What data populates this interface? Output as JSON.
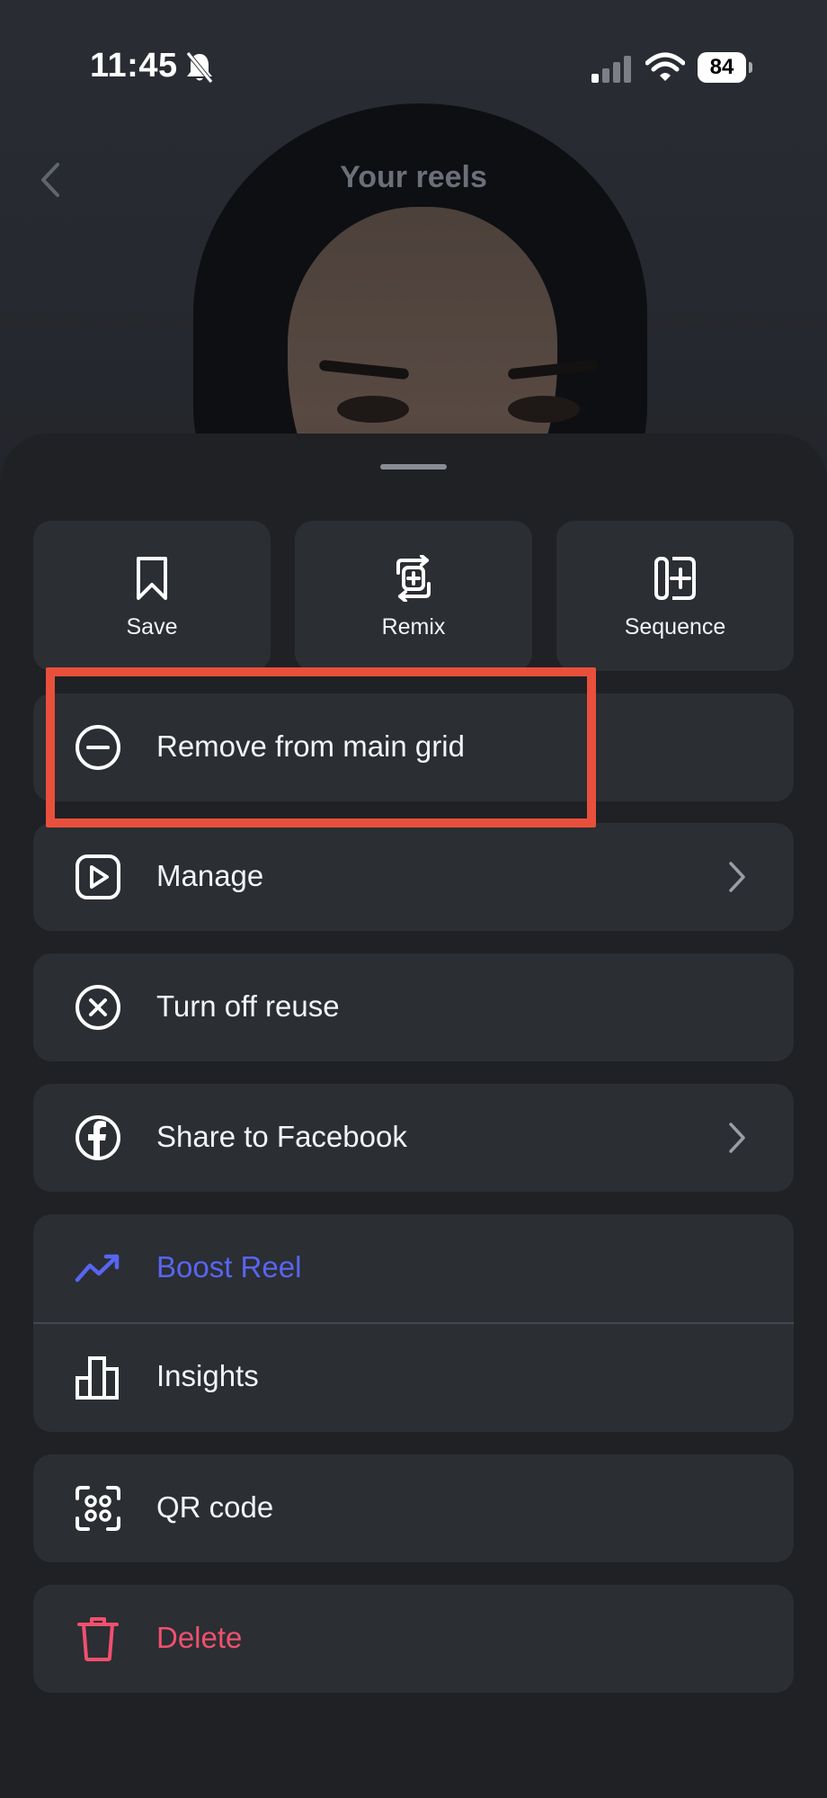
{
  "status_bar": {
    "time": "11:45",
    "battery": "84",
    "icons": [
      "bell-muted-icon",
      "signal-icon",
      "wifi-icon",
      "battery-icon"
    ]
  },
  "nav": {
    "title": "Your reels",
    "back_icon": "chevron-left-icon"
  },
  "quick_actions": [
    {
      "label": "Save",
      "icon": "bookmark-icon"
    },
    {
      "label": "Remix",
      "icon": "remix-icon"
    },
    {
      "label": "Sequence",
      "icon": "sequence-icon"
    }
  ],
  "menu": {
    "remove_from_grid": {
      "label": "Remove from main grid",
      "icon": "minus-circle-icon"
    },
    "manage": {
      "label": "Manage",
      "icon": "reel-play-icon"
    },
    "turn_off_reuse": {
      "label": "Turn off reuse",
      "icon": "x-circle-icon"
    },
    "share_facebook": {
      "label": "Share to Facebook",
      "icon": "facebook-icon"
    },
    "boost_reel": {
      "label": "Boost Reel",
      "icon": "trend-up-icon"
    },
    "insights": {
      "label": "Insights",
      "icon": "bar-chart-icon"
    },
    "qr_code": {
      "label": "QR code",
      "icon": "qr-code-icon"
    },
    "delete": {
      "label": "Delete",
      "icon": "trash-icon"
    }
  },
  "colors": {
    "sheet_bg": "#1f2125",
    "row_bg": "#2b2e33",
    "boost_blue": "#5865f2",
    "delete_red": "#f0506e",
    "highlight_red": "#e8503c"
  }
}
